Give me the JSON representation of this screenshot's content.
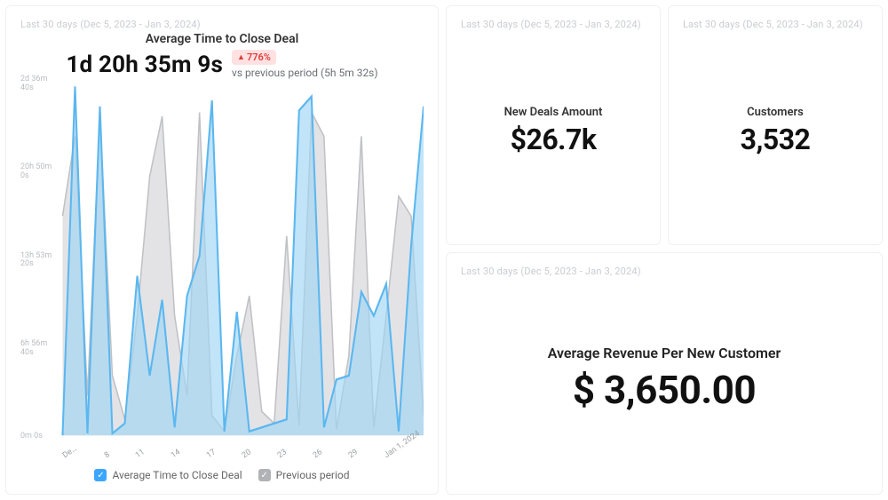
{
  "date_range_text": "Last 30 days (Dec 5, 2023 - Jan 3, 2024)",
  "chart": {
    "title": "Average Time to Close Deal",
    "headline_value": "1d 20h 35m 9s",
    "delta_text": "776%",
    "vs_text": "vs previous period (5h 5m 32s)",
    "legend": {
      "primary": "Average Time to Close Deal",
      "secondary": "Previous period"
    },
    "y_ticks": [
      "2d 36m\n40s",
      "20h 50m\n0s",
      "13h 53m\n20s",
      "6h 56m\n40s",
      "0m 0s"
    ],
    "x_ticks": [
      "De…",
      "8",
      "11",
      "14",
      "17",
      "20",
      "23",
      "26",
      "29",
      "Jan 1, 2024"
    ]
  },
  "kpis": {
    "new_deals_label": "New Deals Amount",
    "new_deals_value": "$26.7k",
    "customers_label": "Customers",
    "customers_value": "3,532",
    "arpc_label": "Average Revenue Per New Customer",
    "arpc_value": "$ 3,650.00"
  },
  "chart_data": {
    "type": "line",
    "title": "Average Time to Close Deal",
    "xlabel": "",
    "ylabel": "",
    "y_unit": "seconds",
    "ylim": [
      0,
      175000
    ],
    "x": [
      "Dec 5",
      "Dec 6",
      "Dec 7",
      "Dec 8",
      "Dec 9",
      "Dec 10",
      "Dec 11",
      "Dec 12",
      "Dec 13",
      "Dec 14",
      "Dec 15",
      "Dec 16",
      "Dec 17",
      "Dec 18",
      "Dec 19",
      "Dec 20",
      "Dec 21",
      "Dec 22",
      "Dec 23",
      "Dec 24",
      "Dec 25",
      "Dec 26",
      "Dec 27",
      "Dec 28",
      "Dec 29",
      "Dec 30",
      "Dec 31",
      "Jan 1",
      "Jan 2",
      "Jan 3"
    ],
    "series": [
      {
        "name": "Average Time to Close Deal",
        "color": "#6cc3f5",
        "values": [
          0,
          175000,
          1000,
          165000,
          1000,
          6000,
          80000,
          30000,
          68000,
          4000,
          70000,
          90000,
          168000,
          2000,
          62000,
          2000,
          4000,
          6000,
          8000,
          163000,
          170000,
          4000,
          28000,
          30000,
          72000,
          60000,
          76000,
          2000,
          95000,
          165000
        ]
      },
      {
        "name": "Previous period",
        "color": "#c8cacc",
        "values": [
          110000,
          150000,
          20000,
          160000,
          30000,
          8000,
          60000,
          130000,
          160000,
          60000,
          20000,
          162000,
          10000,
          2000,
          40000,
          70000,
          12000,
          6000,
          100000,
          5000,
          162000,
          150000,
          3000,
          40000,
          150000,
          4000,
          60000,
          120000,
          110000,
          10000
        ]
      }
    ],
    "x_tick_labels": [
      "De…",
      "8",
      "11",
      "14",
      "17",
      "20",
      "23",
      "26",
      "29",
      "Jan 1, 2024"
    ],
    "y_tick_labels": [
      "0m 0s",
      "6h 56m 40s",
      "13h 53m 20s",
      "20h 50m 0s",
      "2d 36m 40s"
    ]
  }
}
